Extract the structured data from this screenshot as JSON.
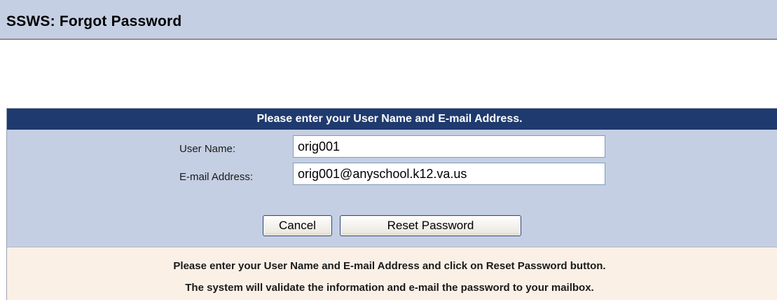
{
  "header": {
    "title": "SSWS: Forgot Password"
  },
  "form": {
    "heading": "Please enter your User Name and E-mail Address.",
    "user_name_label": "User Name:",
    "user_name_value": "orig001",
    "email_label": "E-mail Address:",
    "email_value": "orig001@anyschool.k12.va.us",
    "cancel_label": "Cancel",
    "reset_label": "Reset Password"
  },
  "instructions": {
    "line1": "Please enter your User Name and E-mail Address and click on Reset Password button.",
    "line2": "The system will validate the information and e-mail the password to your mailbox."
  },
  "colors": {
    "title_bar_bg": "#c5cfe3",
    "panel_header_bg": "#1f3a6e",
    "panel_bg": "#c5cfe3",
    "info_bg": "#fbf0e6"
  }
}
